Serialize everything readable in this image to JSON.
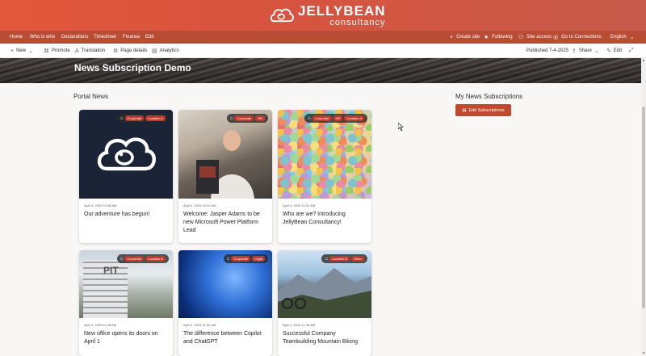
{
  "brand": {
    "name_line1": "JELLYBEAN",
    "name_line2": "consultancy"
  },
  "nav": {
    "left": [
      "Home",
      "Who is who",
      "Declarations",
      "Timesheet",
      "Finance",
      "Edit"
    ],
    "right": {
      "create_site": "Create site",
      "following": "Following",
      "site_access": "Site access",
      "go_to": "Go to Connections",
      "language": "English"
    }
  },
  "command_bar": {
    "new": "New",
    "promote": "Promote",
    "translation": "Translation",
    "page_details": "Page details",
    "analytics": "Analytics",
    "published": "Published 7-4-2025",
    "share": "Share",
    "edit": "Edit"
  },
  "page": {
    "title": "News Subscription Demo"
  },
  "portal_news": {
    "heading": "Portal News",
    "cards": [
      {
        "date": "April 4, 2025 10:36 AM",
        "title": "Our adventure has begun!",
        "tags": [
          "Corporate",
          "Location A"
        ]
      },
      {
        "date": "April 4, 2025 10:40 AM",
        "title": "Welcome: Jasper Adams to be new Microsoft Power Platform Lead",
        "tags": [
          "Corporate",
          "HR"
        ]
      },
      {
        "date": "April 4, 2025 11:22 AM",
        "title": "Who are we? Introducing JellyBean Consultancy!",
        "tags": [
          "Corporate",
          "HR",
          "Location A"
        ]
      },
      {
        "date": "April 4, 2025 11:28 AM",
        "title": "New office opens its doors on April 1",
        "tags": [
          "Corporate",
          "Location B"
        ]
      },
      {
        "date": "April 4, 2025 11:32 AM",
        "title": "The difference between Copilot and ChatGPT",
        "tags": [
          "Corporate",
          "Legal"
        ]
      },
      {
        "date": "April 4, 2025 11:36 AM",
        "title": "Successful Company Teambuilding Mountain Biking",
        "tags": [
          "Location B",
          "Other"
        ]
      }
    ]
  },
  "subscriptions": {
    "heading": "My News Subscriptions",
    "edit_button": "Edit Subscriptions"
  },
  "colors": {
    "brand": "#d7533e",
    "nav": "#b94c35",
    "button": "#bf4a30",
    "tag": "#c0392b"
  }
}
